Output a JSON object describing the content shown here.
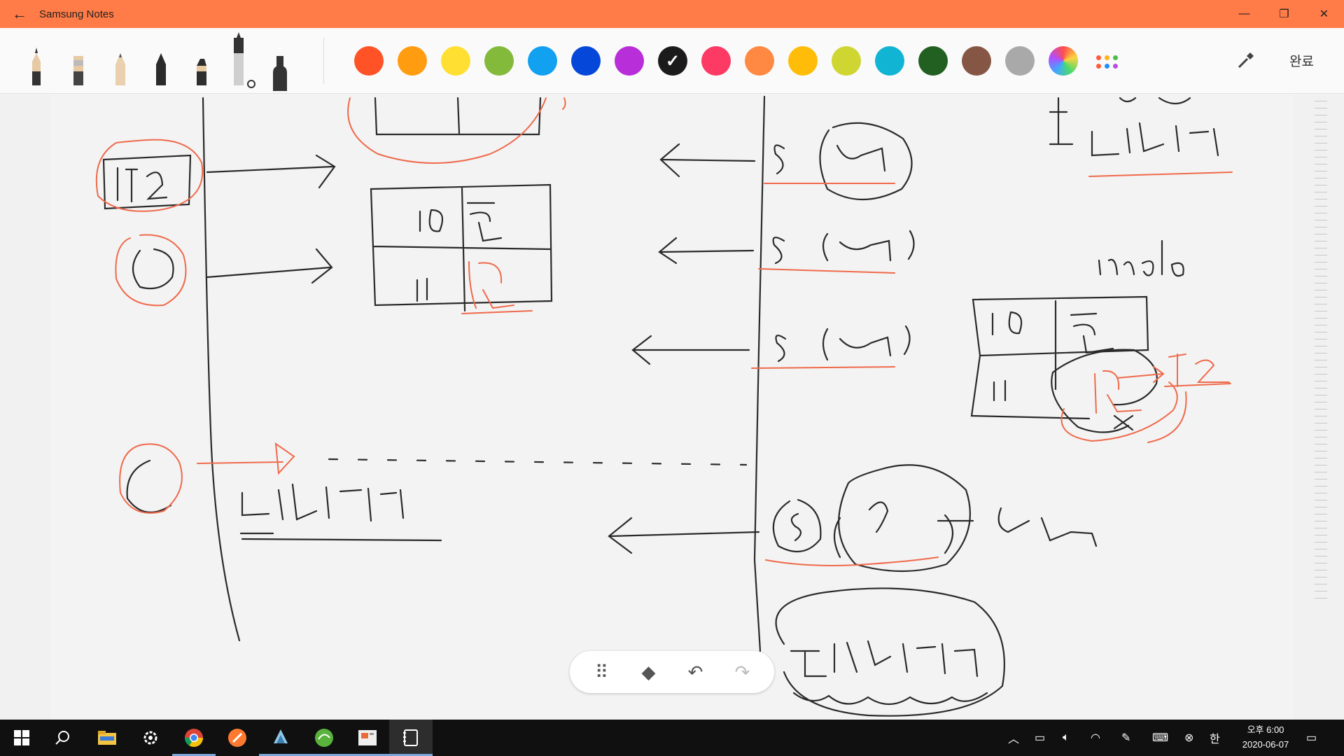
{
  "app": {
    "title": "Samsung Notes",
    "back_glyph": "←",
    "window_controls": {
      "minimize": "—",
      "restore": "❐",
      "close": "✕"
    }
  },
  "toolbar": {
    "pens": [
      {
        "name": "fountain-pen-icon"
      },
      {
        "name": "brush-pen-icon"
      },
      {
        "name": "pencil-icon"
      },
      {
        "name": "ballpoint-pen-icon"
      },
      {
        "name": "marker-icon"
      },
      {
        "name": "pen-settings-icon"
      },
      {
        "name": "highlighter-icon"
      }
    ],
    "colors": [
      {
        "name": "red-orange",
        "hex": "#ff5227"
      },
      {
        "name": "orange",
        "hex": "#ff9c0f"
      },
      {
        "name": "yellow",
        "hex": "#ffe032"
      },
      {
        "name": "green",
        "hex": "#84ba3c"
      },
      {
        "name": "sky-blue",
        "hex": "#12a0f0"
      },
      {
        "name": "blue",
        "hex": "#0547d9"
      },
      {
        "name": "purple",
        "hex": "#b82ed8"
      },
      {
        "name": "black",
        "hex": "#1b1b1b",
        "selected": true
      },
      {
        "name": "pink",
        "hex": "#fc3a63"
      },
      {
        "name": "light-orange",
        "hex": "#ff8842"
      },
      {
        "name": "amber",
        "hex": "#ffbd0a"
      },
      {
        "name": "lime",
        "hex": "#cfd632"
      },
      {
        "name": "teal",
        "hex": "#12b4d4"
      },
      {
        "name": "dark-green",
        "hex": "#216020"
      },
      {
        "name": "brown",
        "hex": "#865644"
      },
      {
        "name": "gray",
        "hex": "#a9a9a9"
      }
    ],
    "selected_check": "✓",
    "done_label": "완료"
  },
  "float_tools": {
    "drag_glyph": "⠿",
    "eraser_glyph": "◆",
    "undo_glyph": "↶",
    "redo_glyph": "↷"
  },
  "taskbar": {
    "items": [
      "start-icon",
      "search-icon",
      "file-explorer-icon",
      "settings-icon",
      "chrome-icon",
      "orange-app-icon",
      "app-icon",
      "green-app-icon",
      "slides-app-icon",
      "notes-app-icon"
    ],
    "clock_line1": "오후 6:00",
    "clock_line2": "2020-06-07",
    "ime": "한"
  }
}
